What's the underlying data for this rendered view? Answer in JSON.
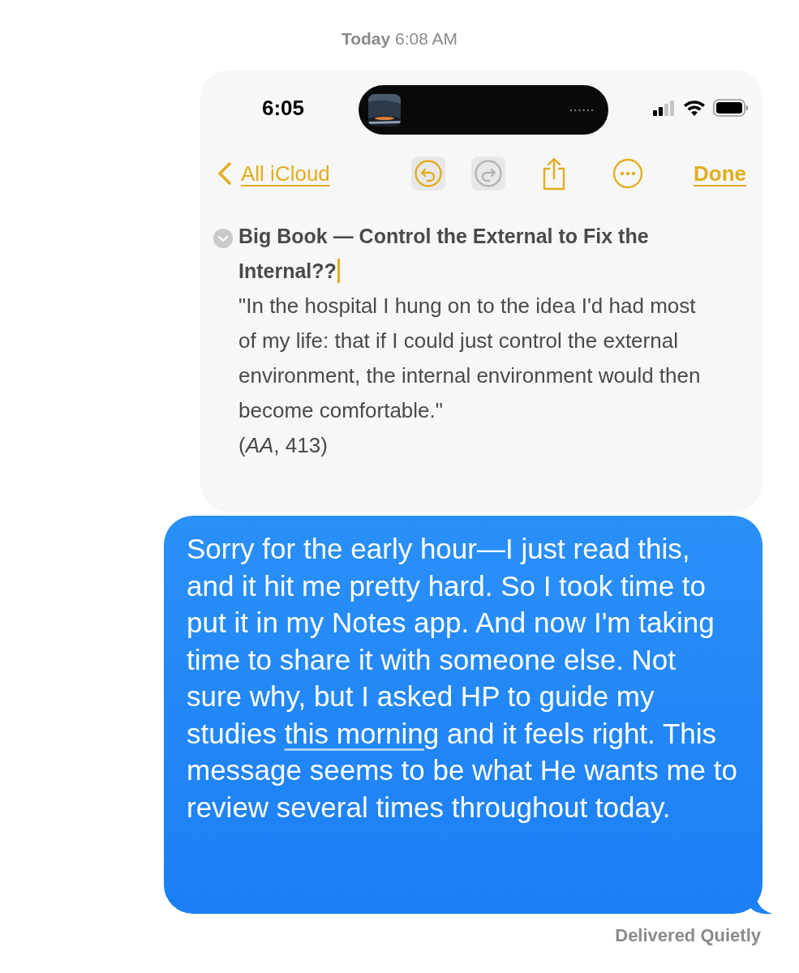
{
  "timestamp": {
    "day": "Today",
    "time": "6:08 AM"
  },
  "screenshot": {
    "status_bar": {
      "time": "6:05"
    },
    "toolbar": {
      "back": "All iCloud",
      "undo": {
        "disabled": false
      },
      "redo": {
        "disabled": true
      },
      "done": "Done"
    },
    "note": {
      "title": "Big Book — Control the External to Fix the Internal??",
      "body": "\"In the hospital I hung on to the idea I'd had most of my life: that if I could just control the external environment, the internal environment would then become comfortable.\"",
      "citation": "(*AA*, 413)"
    }
  },
  "message": {
    "parts": [
      {
        "kind": "text",
        "text": "Sorry for the early hour—I just read this, and it hit me pretty hard. So I took time to put it in my Notes app. And now I'm taking time to share it with someone else. Not sure why, but I asked HP to guide my studies "
      },
      {
        "kind": "link",
        "text": "this morning"
      },
      {
        "kind": "text",
        "text": " and it feels right. This message seems to be what He wants me to review several times throughout today."
      }
    ]
  },
  "status": "Delivered Quietly"
}
